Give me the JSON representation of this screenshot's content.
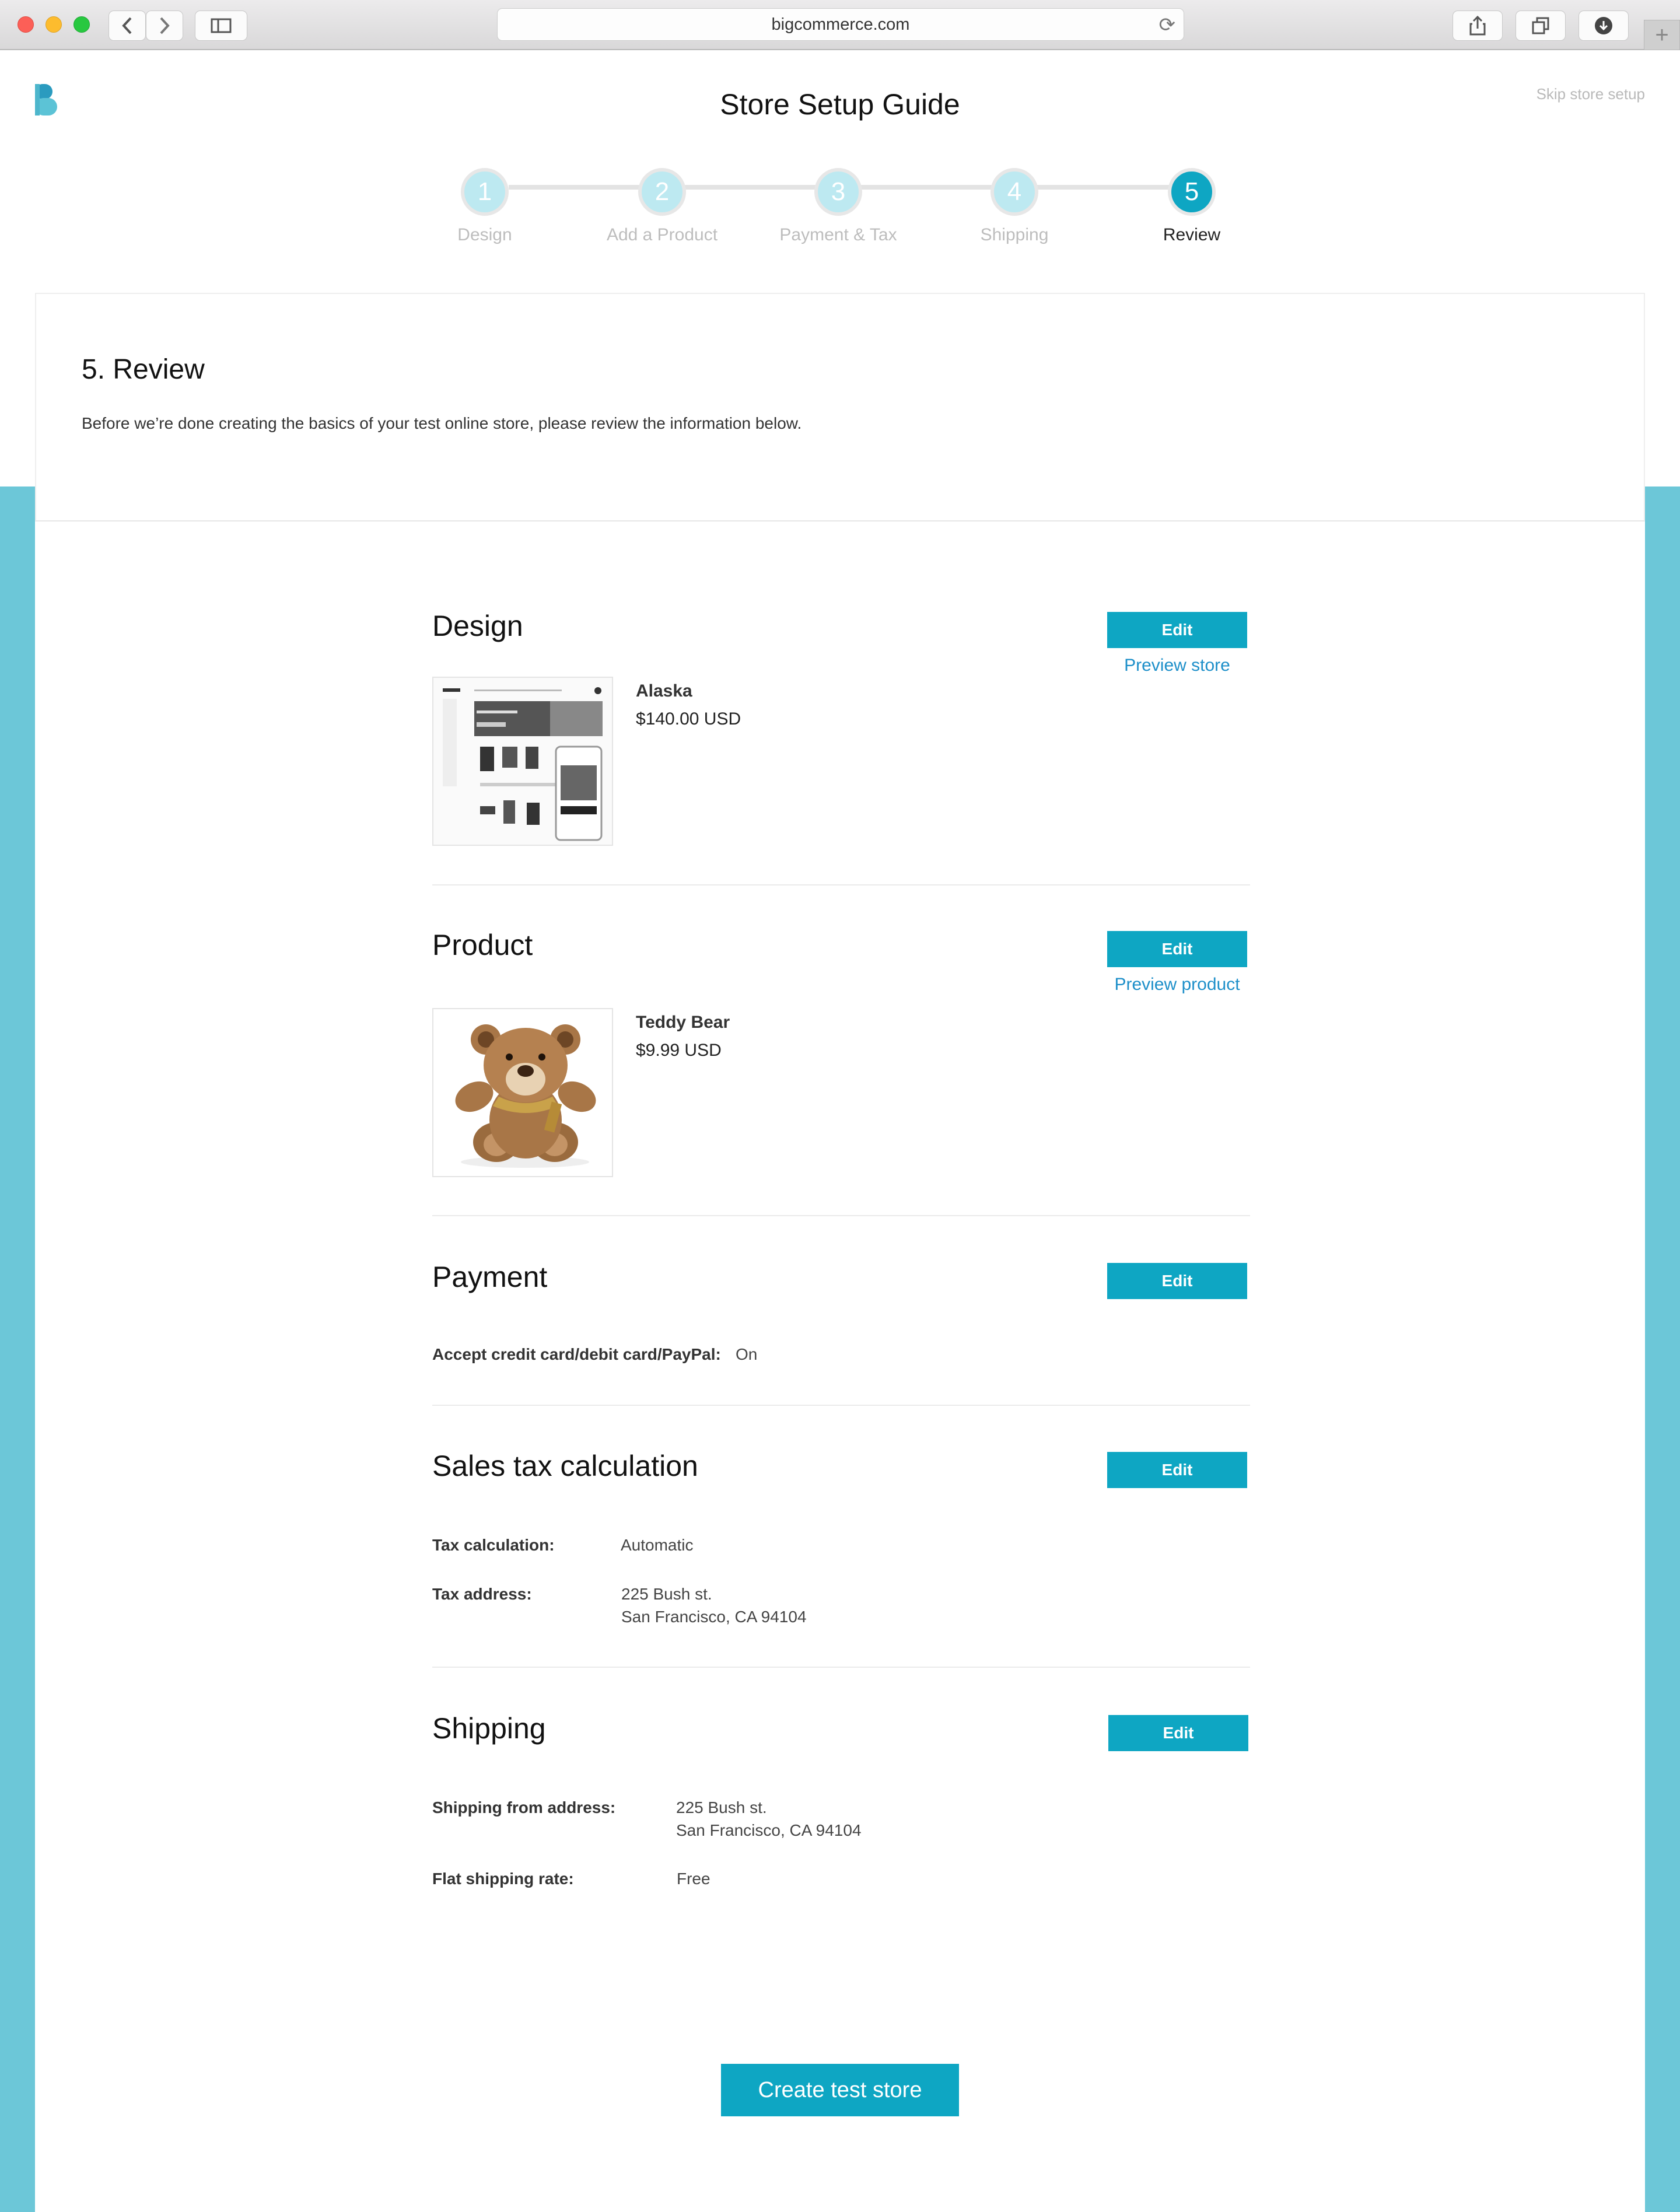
{
  "browser": {
    "url": "bigcommerce.com"
  },
  "header": {
    "title": "Store Setup Guide",
    "skip_link": "Skip store setup"
  },
  "steps": [
    {
      "number": "1",
      "label": "Design"
    },
    {
      "number": "2",
      "label": "Add a Product"
    },
    {
      "number": "3",
      "label": "Payment & Tax"
    },
    {
      "number": "4",
      "label": "Shipping"
    },
    {
      "number": "5",
      "label": "Review"
    }
  ],
  "review": {
    "heading": "5. Review",
    "description": "Before we’re done creating the basics of your test online store, please review the information below."
  },
  "design": {
    "title": "Design",
    "edit": "Edit",
    "preview": "Preview store",
    "theme_name": "Alaska",
    "theme_price": "$140.00 USD"
  },
  "product": {
    "title": "Product",
    "edit": "Edit",
    "preview": "Preview product",
    "name": "Teddy Bear",
    "price": "$9.99 USD"
  },
  "payment": {
    "title": "Payment",
    "edit": "Edit",
    "label": "Accept credit card/debit card/PayPal:",
    "value": "On"
  },
  "tax": {
    "title": "Sales tax calculation",
    "edit": "Edit",
    "calc_label": "Tax calculation:",
    "calc_value": "Automatic",
    "address_label": "Tax address:",
    "address_line1": "225 Bush st.",
    "address_line2": "San Francisco, CA 94104"
  },
  "shipping": {
    "title": "Shipping",
    "edit": "Edit",
    "from_label": "Shipping from address:",
    "from_line1": "225 Bush st.",
    "from_line2": "San Francisco, CA 94104",
    "rate_label": "Flat shipping rate:",
    "rate_value": "Free"
  },
  "footer": {
    "create_button": "Create test store"
  },
  "colors": {
    "accent": "#0ea6c3",
    "background_teal": "#6cc7d8",
    "link": "#1d8fc9"
  }
}
